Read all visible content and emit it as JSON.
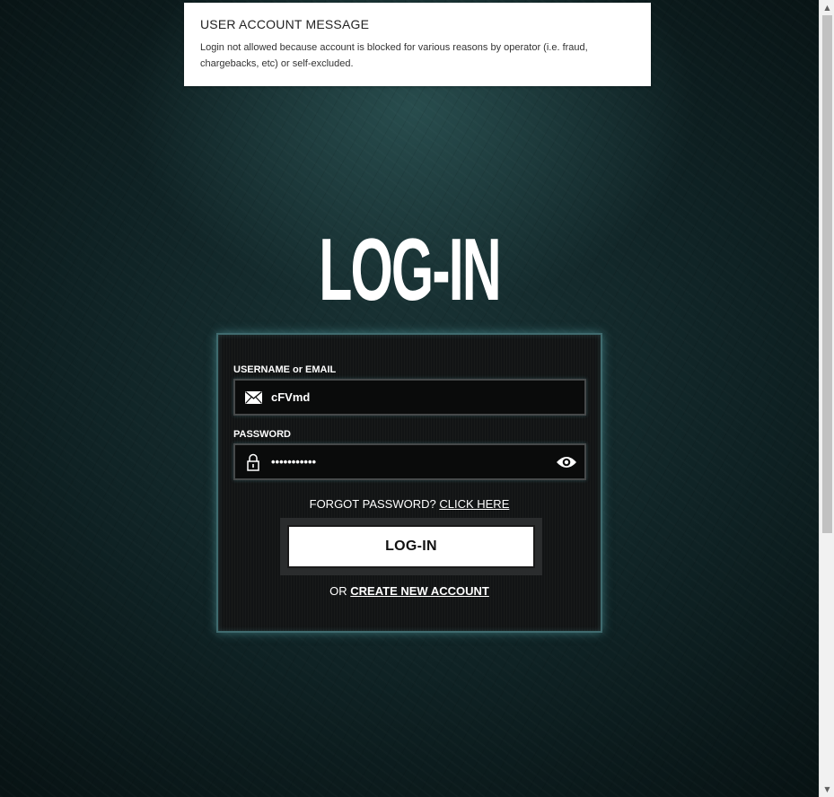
{
  "message": {
    "title": "USER ACCOUNT MESSAGE",
    "text": "Login not allowed because account is blocked for various reasons by operator (i.e. fraud, chargebacks, etc) or self-excluded."
  },
  "page": {
    "title": "LOG-IN"
  },
  "form": {
    "username_label": "USERNAME or EMAIL",
    "username_value": "cFVmd",
    "password_label": "PASSWORD",
    "password_value": "•••••••••••",
    "forgot_text": "FORGOT PASSWORD?",
    "forgot_link": "CLICK HERE",
    "login_button": "LOG-IN",
    "create_prefix": "OR",
    "create_link": "CREATE NEW ACCOUNT"
  },
  "icons": {
    "username": "envelope-icon",
    "password": "lock-icon",
    "toggle_password": "eye-icon"
  },
  "colors": {
    "panel_border": "#3f6a6e",
    "glow": "#5aaaaf",
    "background": "#0f2224"
  }
}
